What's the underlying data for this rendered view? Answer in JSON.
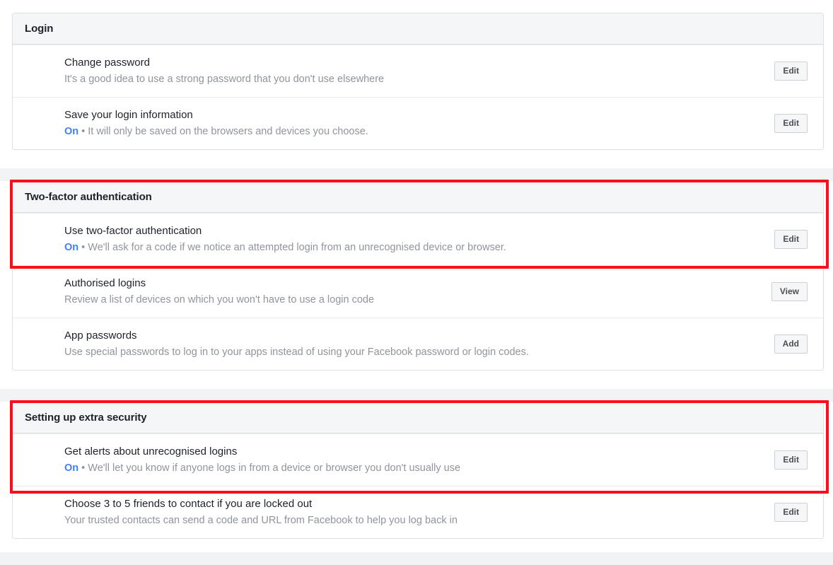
{
  "page": {
    "background_color": "#ffffff",
    "gap_color": "#f2f3f5",
    "card_border_color": "#dddfe2",
    "header_background": "#f5f6f7",
    "highlight_color": "#fc0d1b",
    "accent_on_color": "#4080ff",
    "title_color": "#1d2129",
    "desc_color": "#90949c",
    "button_text_color": "#4b4f56"
  },
  "sections": [
    {
      "id": "login",
      "header": "Login",
      "highlighted": false,
      "rows": [
        {
          "title": "Change password",
          "state": "",
          "desc": "It's a good idea to use a strong password that you don't use elsewhere",
          "action": "Edit"
        },
        {
          "title": "Save your login information",
          "state": "On",
          "separator": "•",
          "desc": "It will only be saved on the browsers and devices you choose.",
          "action": "Edit"
        }
      ]
    },
    {
      "id": "two-factor-authentication",
      "header": "Two-factor authentication",
      "highlighted": true,
      "rows": [
        {
          "title": "Use two-factor authentication",
          "state": "On",
          "separator": "•",
          "desc": "We'll ask for a code if we notice an attempted login from an unrecognised device or browser.",
          "action": "Edit"
        },
        {
          "title": "Authorised logins",
          "state": "",
          "desc": "Review a list of devices on which you won't have to use a login code",
          "action": "View"
        },
        {
          "title": "App passwords",
          "state": "",
          "desc": "Use special passwords to log in to your apps instead of using your Facebook password or login codes.",
          "action": "Add"
        }
      ]
    },
    {
      "id": "setting-up-extra-security",
      "header": "Setting up extra security",
      "highlighted": true,
      "rows": [
        {
          "title": "Get alerts about unrecognised logins",
          "state": "On",
          "separator": "•",
          "desc": "We'll let you know if anyone logs in from a device or browser you don't usually use",
          "action": "Edit"
        },
        {
          "title": "Choose 3 to 5 friends to contact if you are locked out",
          "state": "",
          "desc": "Your trusted contacts can send a code and URL from Facebook to help you log back in",
          "action": "Edit"
        }
      ]
    }
  ]
}
